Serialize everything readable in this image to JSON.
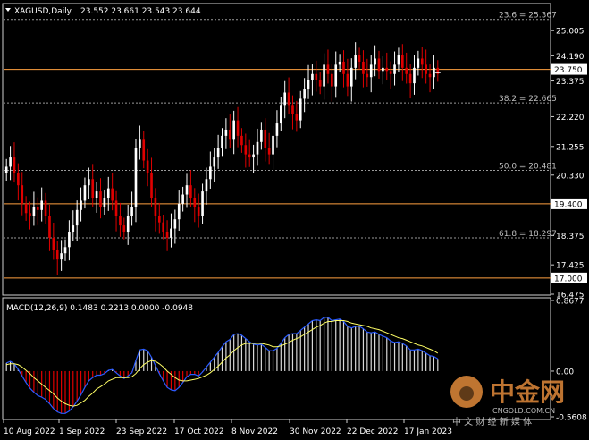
{
  "chart_data": [
    {
      "type": "candlestick",
      "title": "XAGUSD,Daily",
      "ohlc_header": "23.552 23.661 23.543 23.644",
      "ylim": [
        16.475,
        25.85
      ],
      "y_ticks": [
        "25.005",
        "24.190",
        "23.375",
        "22.220",
        "21.255",
        "20.330",
        "18.375",
        "17.425",
        "16.475"
      ],
      "x_ticks": [
        "10 Aug 2022",
        "1 Sep 2022",
        "23 Sep 2022",
        "17 Oct 2022",
        "8 Nov 2022",
        "30 Nov 2022",
        "22 Dec 2022",
        "17 Jan 2023"
      ],
      "fibonacci": [
        {
          "label": "23.6 = 25.367",
          "value": 25.367
        },
        {
          "label": "38.2 = 22.665",
          "value": 22.665
        },
        {
          "label": "50.0 = 20.481",
          "value": 20.481
        },
        {
          "label": "61.8 = 18.297",
          "value": 18.297
        }
      ],
      "price_lines": [
        {
          "label": "23.750",
          "value": 23.75,
          "color": "#ffa040"
        },
        {
          "label": "19.400",
          "value": 19.4,
          "color": "#ffa040"
        },
        {
          "label": "17.000",
          "value": 17.0,
          "color": "#ffa040"
        }
      ],
      "closes": [
        20.6,
        20.9,
        20.4,
        20.0,
        19.4,
        19.1,
        19.0,
        19.3,
        19.2,
        19.5,
        19.0,
        18.3,
        17.9,
        17.6,
        17.8,
        18.0,
        18.5,
        18.7,
        19.2,
        19.5,
        20.0,
        20.2,
        19.6,
        19.8,
        19.3,
        19.6,
        19.9,
        19.5,
        19.0,
        18.7,
        18.5,
        19.0,
        19.3,
        21.2,
        21.5,
        20.8,
        20.4,
        19.6,
        19.0,
        18.8,
        18.5,
        18.3,
        18.6,
        18.9,
        19.4,
        19.7,
        20.0,
        19.6,
        19.3,
        19.0,
        19.8,
        20.2,
        20.6,
        20.9,
        21.2,
        21.6,
        21.8,
        21.5,
        22.1,
        21.6,
        21.3,
        21.0,
        20.9,
        21.0,
        21.4,
        21.8,
        21.2,
        21.0,
        21.6,
        22.0,
        22.6,
        23.0,
        22.6,
        22.3,
        22.1,
        22.8,
        23.1,
        23.4,
        23.6,
        23.4,
        23.2,
        23.9,
        23.6,
        23.2,
        23.9,
        24.0,
        23.6,
        23.2,
        23.8,
        24.2,
        24.0,
        23.6,
        23.5,
        23.9,
        24.1,
        23.7,
        23.8,
        23.7,
        23.6,
        23.9,
        24.2,
        23.8,
        23.6,
        23.3,
        23.8,
        24.1,
        23.9,
        23.6,
        23.5,
        23.8,
        23.6
      ]
    },
    {
      "type": "bar+line",
      "title": "MACD(12,26,9) 0.1483 0.2213 0.0000 -0.0948",
      "ylim": [
        -0.5608,
        0.8677
      ],
      "y_ticks": [
        "0.8677",
        "0.00",
        "-0.5608"
      ],
      "series": [
        {
          "values": [
            0.1,
            0.12,
            0.09,
            0.02,
            -0.06,
            -0.14,
            -0.21,
            -0.26,
            -0.3,
            -0.32,
            -0.35,
            -0.4,
            -0.46,
            -0.5,
            -0.52,
            -0.52,
            -0.49,
            -0.44,
            -0.37,
            -0.29,
            -0.2,
            -0.12,
            -0.08,
            -0.05,
            -0.05,
            -0.03,
            0.01,
            0.02,
            -0.02,
            -0.06,
            -0.09,
            -0.06,
            -0.02,
            0.13,
            0.26,
            0.27,
            0.25,
            0.17,
            0.07,
            -0.03,
            -0.12,
            -0.2,
            -0.23,
            -0.24,
            -0.2,
            -0.14,
            -0.07,
            -0.04,
            -0.04,
            -0.06,
            -0.01,
            0.05,
            0.11,
            0.17,
            0.23,
            0.3,
            0.36,
            0.39,
            0.45,
            0.46,
            0.44,
            0.4,
            0.36,
            0.33,
            0.32,
            0.33,
            0.29,
            0.25,
            0.25,
            0.28,
            0.34,
            0.41,
            0.45,
            0.46,
            0.46,
            0.5,
            0.54,
            0.58,
            0.62,
            0.63,
            0.62,
            0.66,
            0.66,
            0.62,
            0.63,
            0.64,
            0.61,
            0.55,
            0.53,
            0.55,
            0.55,
            0.52,
            0.48,
            0.47,
            0.48,
            0.45,
            0.43,
            0.41,
            0.37,
            0.35,
            0.36,
            0.34,
            0.31,
            0.26,
            0.26,
            0.27,
            0.25,
            0.22,
            0.19,
            0.18,
            0.15
          ]
        },
        {
          "values": [
            0.08,
            0.09,
            0.09,
            0.08,
            0.05,
            0.01,
            -0.03,
            -0.08,
            -0.12,
            -0.16,
            -0.2,
            -0.24,
            -0.28,
            -0.33,
            -0.37,
            -0.4,
            -0.42,
            -0.43,
            -0.42,
            -0.39,
            -0.36,
            -0.31,
            -0.27,
            -0.22,
            -0.19,
            -0.16,
            -0.12,
            -0.1,
            -0.08,
            -0.08,
            -0.08,
            -0.08,
            -0.07,
            -0.03,
            0.03,
            0.08,
            0.11,
            0.13,
            0.12,
            0.09,
            0.05,
            0.0,
            -0.04,
            -0.08,
            -0.11,
            -0.12,
            -0.12,
            -0.11,
            -0.1,
            -0.09,
            -0.07,
            -0.05,
            -0.02,
            0.02,
            0.06,
            0.11,
            0.16,
            0.2,
            0.25,
            0.29,
            0.32,
            0.34,
            0.34,
            0.34,
            0.34,
            0.34,
            0.33,
            0.32,
            0.3,
            0.3,
            0.31,
            0.33,
            0.35,
            0.38,
            0.4,
            0.42,
            0.45,
            0.48,
            0.51,
            0.54,
            0.56,
            0.59,
            0.61,
            0.61,
            0.62,
            0.62,
            0.62,
            0.61,
            0.59,
            0.58,
            0.57,
            0.56,
            0.55,
            0.53,
            0.52,
            0.51,
            0.49,
            0.47,
            0.45,
            0.43,
            0.41,
            0.4,
            0.38,
            0.36,
            0.34,
            0.32,
            0.31,
            0.29,
            0.27,
            0.25,
            0.22
          ]
        }
      ]
    }
  ],
  "watermark": {
    "brand": "中金网",
    "site": "CNGOLD.COM.CN",
    "slogan": "中 文 财 经 新 媒 体"
  }
}
